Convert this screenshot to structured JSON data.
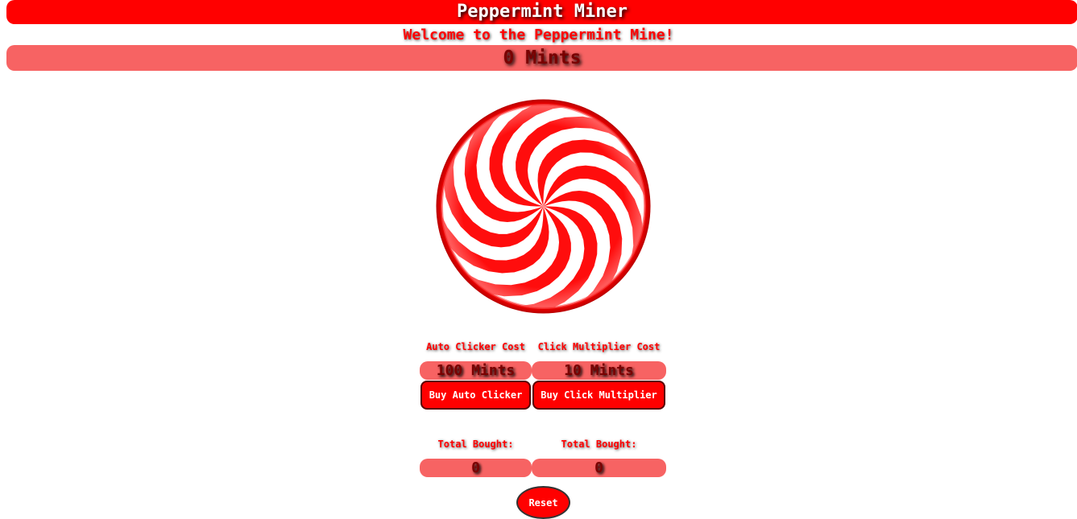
{
  "header": {
    "title": "Peppermint Miner",
    "welcome": "Welcome to the Peppermint Mine!",
    "mint_count": "0 Mints"
  },
  "candy": {
    "icon": "peppermint-candy-icon"
  },
  "shop": {
    "auto_clicker": {
      "cost_label": "Auto Clicker Cost",
      "cost_value": "100 Mints",
      "buy_label": "Buy Auto Clicker",
      "bought_label": "Total Bought:",
      "bought_value": "0"
    },
    "click_multiplier": {
      "cost_label": "Click Multiplier Cost",
      "cost_value": "10 Mints",
      "buy_label": "Buy Click Multiplier",
      "bought_label": "Total Bought:",
      "bought_value": "0"
    }
  },
  "controls": {
    "reset_label": "Reset"
  },
  "colors": {
    "primary_red": "#ff0000",
    "pill_pink": "#f76363",
    "dark_red_text": "#7a0000",
    "white": "#ffffff"
  }
}
